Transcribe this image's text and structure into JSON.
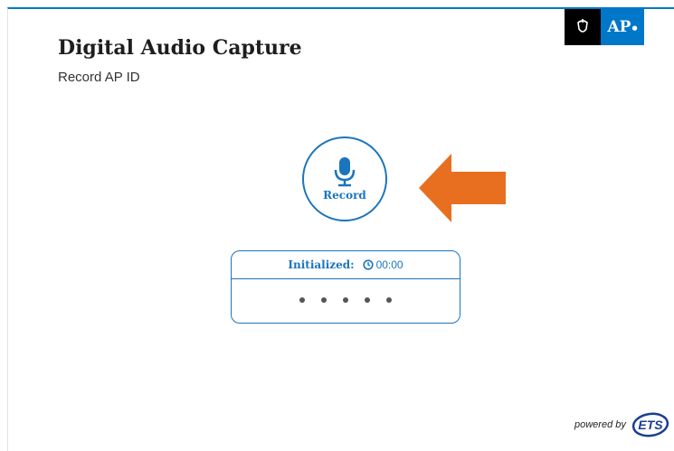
{
  "header": {
    "title": "Digital Audio Capture",
    "subtitle": "Record AP ID"
  },
  "logo": {
    "text": "AP"
  },
  "recorder": {
    "button_label": "Record",
    "status_label": "Initialized:",
    "timer": "00:00",
    "dots": 5
  },
  "footer": {
    "powered_by": "powered by",
    "brand": "ETS"
  },
  "colors": {
    "accent": "#1b75bc",
    "arrow": "#e86f1f",
    "logo_blue": "#0077c8"
  }
}
